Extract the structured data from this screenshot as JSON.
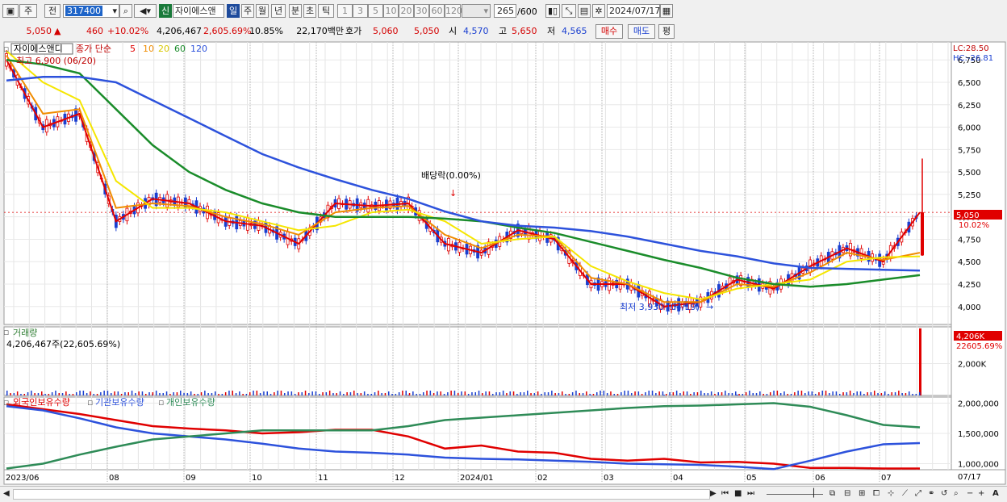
{
  "toolbar": {
    "mode": "주",
    "prev_label": "전",
    "code": "317400",
    "market_badge": "신",
    "stock_name": "자이에스앤",
    "periods": [
      "일",
      "주",
      "월",
      "년",
      "분",
      "초",
      "틱"
    ],
    "active_period": "일",
    "minute_steps": [
      "1",
      "3",
      "5",
      "10",
      "20",
      "30",
      "60",
      "120"
    ],
    "bar_count": "265",
    "bar_max": "/600",
    "date": "2024/07/17"
  },
  "quote": {
    "price": "5,050",
    "change": "460",
    "change_pct": "+10.02%",
    "volume": "4,206,467",
    "volume_ratio": "2,605.69%",
    "turnover": "10.85%",
    "amount": "22,170백만",
    "ask_label": "호가",
    "ask1": "5,060",
    "ask2": "5,050",
    "open_label": "시",
    "open": "4,570",
    "high_label": "고",
    "high": "5,650",
    "low_label": "저",
    "low": "4,565",
    "buy_label": "매수",
    "sell_label": "매도",
    "eval_label": "평"
  },
  "price_panel": {
    "stock_name": "자이에스앤디",
    "ma_legend_prefix": "종가 단순",
    "ma_periods": [
      "5",
      "10",
      "20",
      "60",
      "120"
    ],
    "high_note": "최고 6,900 (06/20)",
    "low_note": "최저 3,930 (04/19)",
    "dividend_note": "배당락(0.00%)",
    "lc_label": "LC:28.50",
    "hc_label": "HC:-26.81",
    "current_price_tag": "5,050",
    "current_pct_tag": "10.02%"
  },
  "volume_panel": {
    "title": "거래량",
    "summary": "4,206,467주(22,605.69%)",
    "last_value_tag": "4,206K",
    "last_pct_tag": "22605.69%"
  },
  "holdings_panel": {
    "titles": [
      "외국인보유수량",
      "기관보유수량",
      "개인보유수량"
    ]
  },
  "colors": {
    "ma5": "#e00000",
    "ma10": "#f08c00",
    "ma20": "#f5e600",
    "ma60": "#1a8c2a",
    "ma120": "#2d52dc",
    "foreign": "#e00000",
    "institution": "#2d52dc",
    "individual": "#2e8b57",
    "up_candle": "#e00000",
    "down_candle": "#1a3fd0"
  },
  "chart_data": [
    {
      "type": "line",
      "name": "price",
      "x": [
        "2023/06",
        "08",
        "09",
        "10",
        "11",
        "12",
        "2024/01",
        "02",
        "03",
        "04",
        "05",
        "06",
        "07"
      ],
      "ylim": [
        3800,
        6950
      ],
      "yticks": [
        4000,
        4250,
        4500,
        4750,
        5000,
        5250,
        5500,
        5750,
        6000,
        6250,
        6500,
        6750
      ],
      "series": [
        {
          "name": "5",
          "values": [
            6750,
            6000,
            6150,
            4950,
            5200,
            5150,
            4950,
            4900,
            4700,
            5150,
            5120,
            5150,
            4700,
            4600,
            4850,
            4750,
            4250,
            4250,
            4000,
            4050,
            4300,
            4200,
            4450,
            4650,
            4500,
            5050
          ]
        },
        {
          "name": "10",
          "values": [
            6800,
            6150,
            6200,
            5100,
            5150,
            5120,
            5000,
            4920,
            4800,
            5050,
            5100,
            5120,
            4800,
            4650,
            4800,
            4780,
            4320,
            4250,
            4050,
            4050,
            4250,
            4220,
            4380,
            4600,
            4520,
            4600
          ]
        },
        {
          "name": "20",
          "values": [
            6850,
            6500,
            6300,
            5400,
            5100,
            5100,
            5050,
            4950,
            4850,
            4900,
            5050,
            5080,
            4950,
            4700,
            4750,
            4780,
            4450,
            4280,
            4150,
            4080,
            4200,
            4250,
            4300,
            4500,
            4550,
            4560
          ]
        },
        {
          "name": "60",
          "values": [
            6750,
            6700,
            6600,
            6200,
            5800,
            5500,
            5300,
            5150,
            5050,
            5000,
            5000,
            5000,
            4980,
            4950,
            4880,
            4820,
            4720,
            4620,
            4520,
            4430,
            4320,
            4250,
            4220,
            4250,
            4300,
            4350
          ]
        },
        {
          "name": "120",
          "values": [
            6520,
            6560,
            6560,
            6500,
            6300,
            6100,
            5900,
            5700,
            5550,
            5420,
            5300,
            5200,
            5060,
            4950,
            4900,
            4880,
            4840,
            4780,
            4700,
            4620,
            4560,
            4480,
            4430,
            4420,
            4410,
            4400
          ]
        }
      ]
    },
    {
      "type": "bar",
      "name": "volume",
      "x": [
        "2023/06",
        "08",
        "09",
        "10",
        "11",
        "12",
        "2024/01",
        "02",
        "03",
        "04",
        "05",
        "06",
        "07"
      ],
      "ylim": [
        0,
        4300000
      ],
      "yticks": [
        2000000
      ],
      "ytick_labels": [
        "2,000K"
      ],
      "last_value": 4206467,
      "values": [
        30000,
        45000,
        22000,
        18000,
        60000,
        25000,
        20000,
        15000,
        35000,
        12000,
        28000,
        40000,
        18000,
        14000,
        22000,
        16000,
        30000,
        20000,
        45000,
        25000,
        55000,
        18000,
        24000,
        30000,
        20000,
        4206467
      ]
    },
    {
      "type": "line",
      "name": "holdings",
      "x": [
        "2023/06",
        "08",
        "09",
        "10",
        "11",
        "12",
        "2024/01",
        "02",
        "03",
        "04",
        "05",
        "06",
        "07"
      ],
      "ylim": [
        900000,
        2100000
      ],
      "yticks": [
        1000000,
        1500000,
        2000000
      ],
      "ytick_labels": [
        "1,000,000",
        "1,500,000",
        "2,000,000"
      ],
      "series": [
        {
          "name": "외국인보유수량",
          "values": [
            1980000,
            1900000,
            1820000,
            1720000,
            1620000,
            1580000,
            1550000,
            1500000,
            1520000,
            1560000,
            1560000,
            1450000,
            1250000,
            1300000,
            1200000,
            1180000,
            1080000,
            1050000,
            1080000,
            1020000,
            1030000,
            1000000,
            930000,
            930000,
            920000,
            920000
          ]
        },
        {
          "name": "기관보유수량",
          "values": [
            1950000,
            1880000,
            1750000,
            1600000,
            1500000,
            1450000,
            1400000,
            1330000,
            1250000,
            1200000,
            1180000,
            1150000,
            1100000,
            1080000,
            1070000,
            1050000,
            1030000,
            1000000,
            990000,
            980000,
            950000,
            910000,
            1050000,
            1200000,
            1320000,
            1340000
          ]
        },
        {
          "name": "개인보유수량",
          "values": [
            920000,
            1000000,
            1150000,
            1280000,
            1400000,
            1450000,
            1500000,
            1550000,
            1550000,
            1550000,
            1550000,
            1620000,
            1720000,
            1760000,
            1800000,
            1840000,
            1880000,
            1920000,
            1950000,
            1960000,
            1980000,
            2000000,
            1940000,
            1800000,
            1640000,
            1600000
          ]
        }
      ]
    }
  ],
  "x_axis_right_label": "07/17"
}
